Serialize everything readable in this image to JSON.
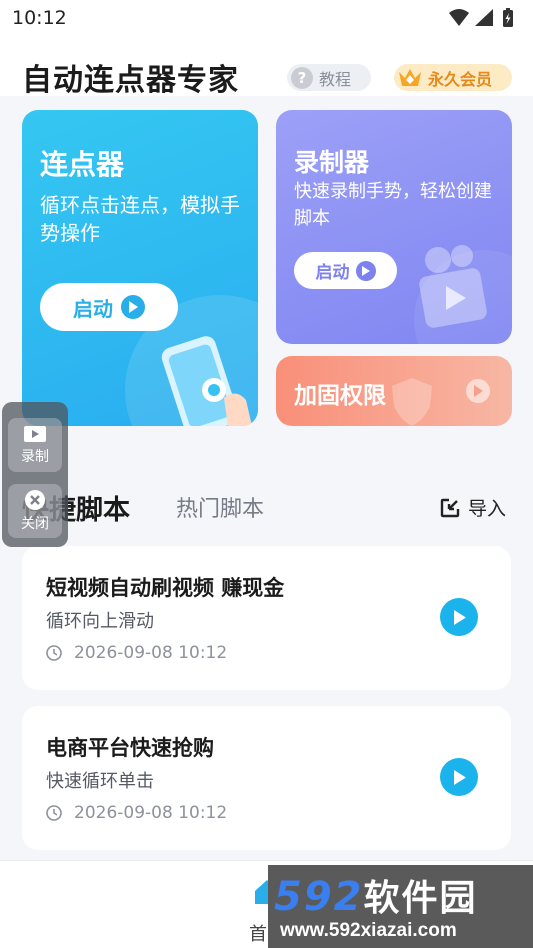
{
  "status_bar": {
    "time": "10:12"
  },
  "header": {
    "title": "自动连点器专家",
    "tutorial_label": "教程",
    "vip_label": "永久会员"
  },
  "cards": {
    "clicker": {
      "title": "连点器",
      "desc": "循环点击连点，模拟手势操作",
      "start_label": "启动"
    },
    "recorder": {
      "title": "录制器",
      "desc": "快速录制手势，轻松创建脚本",
      "start_label": "启动"
    },
    "permission": {
      "title": "加固权限"
    }
  },
  "tabs": {
    "quick": "快捷脚本",
    "hot": "热门脚本",
    "import_label": "导入"
  },
  "scripts": [
    {
      "title": "短视频自动刷视频 赚现金",
      "desc": "循环向上滑动",
      "time": "2026-09-08 10:12"
    },
    {
      "title": "电商平台快速抢购",
      "desc": "快速循环单击",
      "time": "2026-09-08 10:12"
    }
  ],
  "float_panel": {
    "record_label": "录制",
    "close_label": "关闭"
  },
  "bottom_nav": {
    "home_label": "首"
  },
  "watermark": {
    "brand": "592软件园",
    "digits": "592",
    "cn": "软件园",
    "url": "www.592xiazai.com"
  },
  "colors": {
    "accent_blue": "#2aaee9",
    "accent_purple": "#7f86f1",
    "accent_orange": "#f98f79",
    "vip_gold": "#e58a1a"
  }
}
